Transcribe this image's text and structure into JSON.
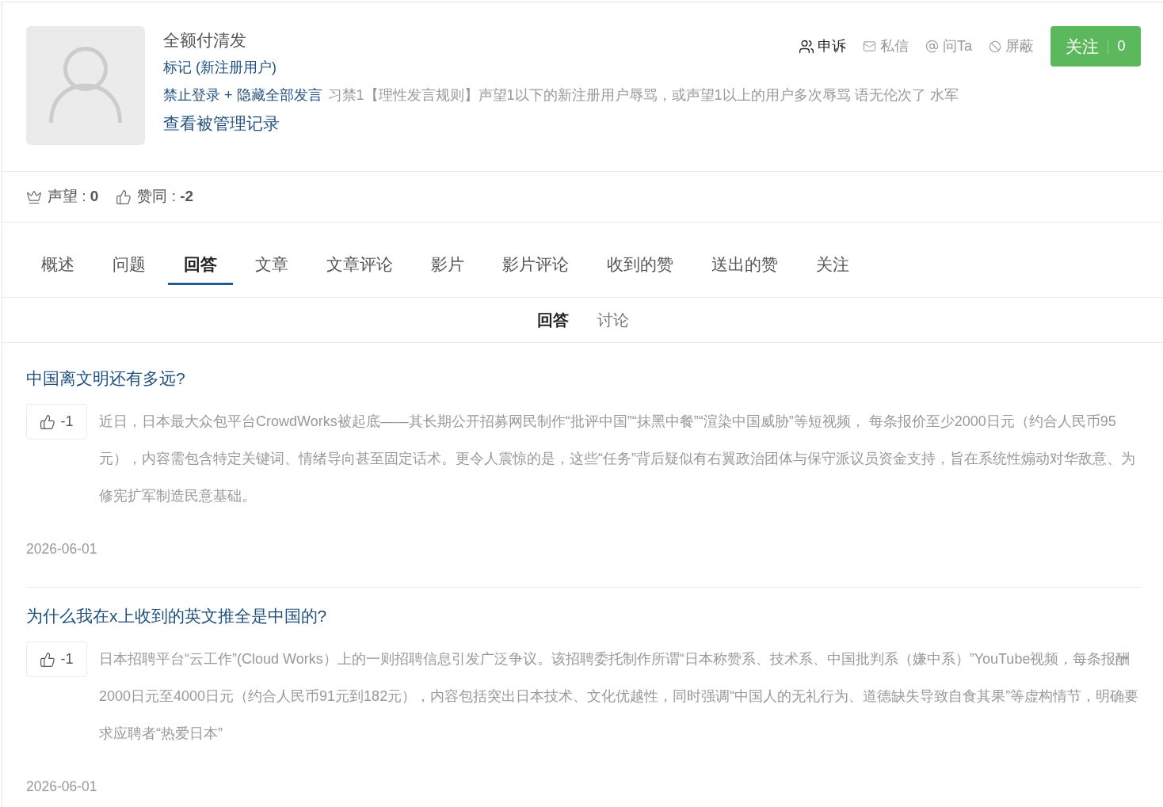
{
  "profile": {
    "name": "全额付清发",
    "tag": "标记 (新注册用户)",
    "penalty": "禁止登录 + 隐藏全部发言",
    "penalty_reason": "习禁1【理性发言规则】声望1以下的新注册用户辱骂，或声望1以上的用户多次辱骂 语无伦次了 水军",
    "records_link": "查看被管理记录"
  },
  "actions": [
    {
      "kind": "appeal",
      "label": "申诉",
      "emphasized": true
    },
    {
      "kind": "message",
      "label": "私信",
      "emphasized": false
    },
    {
      "kind": "ask",
      "label": "问Ta",
      "emphasized": false
    },
    {
      "kind": "block",
      "label": "屏蔽",
      "emphasized": false
    }
  ],
  "follow_button": {
    "label": "关注",
    "count": "0"
  },
  "stats": [
    {
      "kind": "reputation",
      "text": "声望 : **0**"
    },
    {
      "kind": "agree",
      "text": "赞同 : **-2**"
    }
  ],
  "tabs": [
    {
      "label": "概述",
      "selected": false
    },
    {
      "label": "问题",
      "selected": false
    },
    {
      "label": "回答",
      "selected": true
    },
    {
      "label": "文章",
      "selected": false
    },
    {
      "label": "文章评论",
      "selected": false
    },
    {
      "label": "影片",
      "selected": false
    },
    {
      "label": "影片评论",
      "selected": false
    },
    {
      "label": "收到的赞",
      "selected": false
    },
    {
      "label": "送出的赞",
      "selected": false
    },
    {
      "label": "关注",
      "selected": false
    }
  ],
  "subtabs": [
    {
      "label": "回答",
      "selected": true
    },
    {
      "label": "讨论",
      "selected": false
    }
  ],
  "answers": [
    {
      "title": "中国离文明还有多远?",
      "votes": "-1",
      "body": "近日，日本最大众包平台CrowdWorks被起底——其长期公开招募网民制作“批评中国”“抹黑中餐”“渲染中国威胁”等短视频， 每条报价至少2000日元（约合人民币95元），内容需包含特定关键词、情绪导向甚至固定话术。更令人震惊的是，这些“任务”背后疑似有右翼政治团体与保守派议员资金支持，旨在系统性煽动对华敌意、为修宪扩军制造民意基础。",
      "date": "2026-06-01"
    },
    {
      "title": "为什么我在x上收到的英文推全是中国的?",
      "votes": "-1",
      "body": "日本招聘平台“云工作”(Cloud Works）上的一则招聘信息引发广泛争议。该招聘委托制作所谓“日本称赞系、技术系、中国批判系（嫌中系）”YouTube视频，每条报酬2000日元至4000日元（约合人民币91元到182元），内容包括突出日本技术、文化优越性，同时强调“中国人的无礼行为、道德缺失导致自食其果”等虚构情节，明确要求应聘者“热爱日本”",
      "date": "2026-06-01"
    }
  ]
}
